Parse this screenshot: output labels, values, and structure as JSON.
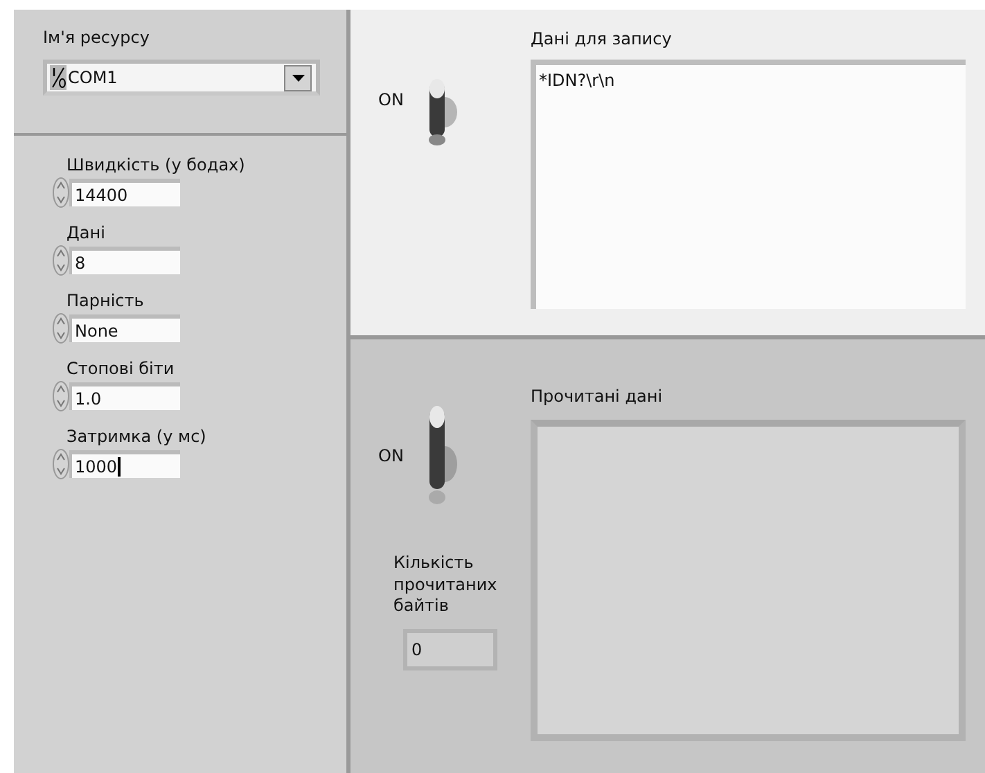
{
  "resource": {
    "label": "Ім'я ресурсу",
    "value": "COM1"
  },
  "settings": [
    {
      "label": "Швидкість (у бодах)",
      "value": "14400",
      "focused": false
    },
    {
      "label": "Дані",
      "value": "8",
      "focused": false
    },
    {
      "label": "Парність",
      "value": "None",
      "focused": false
    },
    {
      "label": "Стопові біти",
      "value": "1.0",
      "focused": false
    },
    {
      "label": "Затримка (у мс)",
      "value": "1000",
      "focused": true
    }
  ],
  "write": {
    "switch_label": "ON",
    "on": true,
    "label": "Дані для запису",
    "value": "*IDN?\\r\\n"
  },
  "read": {
    "switch_label": "ON",
    "on": true,
    "label": "Прочитані дані",
    "count_label": "Кількість прочитаних байтів",
    "count": "0"
  }
}
